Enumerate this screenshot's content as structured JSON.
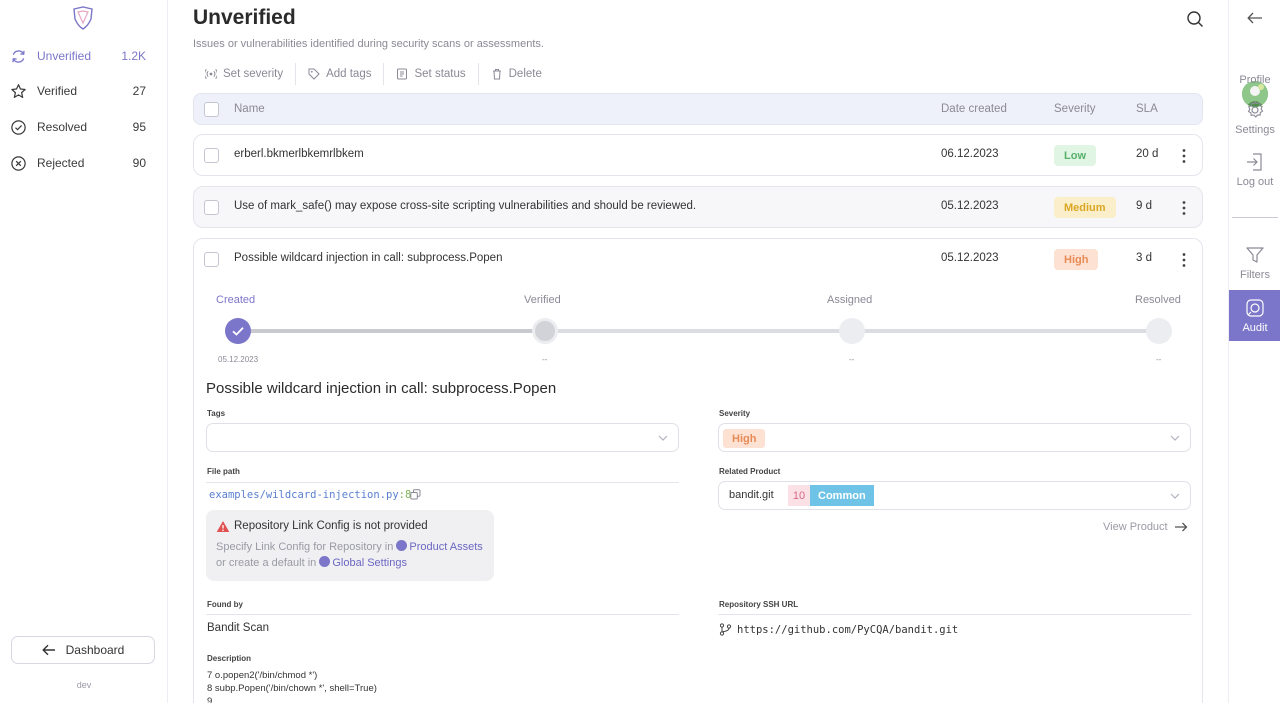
{
  "sidebar": {
    "items": [
      {
        "label": "Unverified",
        "count": "1.2K",
        "icon": "refresh-icon"
      },
      {
        "label": "Verified",
        "count": "27",
        "icon": "star-icon"
      },
      {
        "label": "Resolved",
        "count": "95",
        "icon": "check-circle-icon"
      },
      {
        "label": "Rejected",
        "count": "90",
        "icon": "x-circle-icon"
      }
    ],
    "dashboard_label": "Dashboard",
    "env": "dev"
  },
  "header": {
    "title": "Unverified",
    "subtitle": "Issues or vulnerabilities identified during security scans or assessments."
  },
  "toolbar": {
    "set_severity": "Set severity",
    "add_tags": "Add tags",
    "set_status": "Set status",
    "delete": "Delete"
  },
  "table": {
    "columns": {
      "name": "Name",
      "date": "Date created",
      "severity": "Severity",
      "sla": "SLA"
    },
    "rows": [
      {
        "name": "erberl.bkmerlbkemrlbkem",
        "date": "06.12.2023",
        "severity": "Low",
        "sla": "20 d"
      },
      {
        "name": "Use of mark_safe() may expose cross-site scripting vulnerabilities and should be reviewed.",
        "date": "05.12.2023",
        "severity": "Medium",
        "sla": "9 d"
      },
      {
        "name": "Possible wildcard injection in call: subprocess.Popen",
        "date": "05.12.2023",
        "severity": "High",
        "sla": "3 d"
      }
    ]
  },
  "details": {
    "steps": [
      {
        "label": "Created",
        "date": "05.12.2023"
      },
      {
        "label": "Verified",
        "date": "--"
      },
      {
        "label": "Assigned",
        "date": "--"
      },
      {
        "label": "Resolved",
        "date": "--"
      }
    ],
    "title": "Possible wildcard injection in call: subprocess.Popen",
    "tags_label": "Tags",
    "severity_label": "Severity",
    "severity_value": "High",
    "file_path_label": "File path",
    "file_path": "examples/wildcard-injection.py",
    "file_line": ":8",
    "related_product_label": "Related Product",
    "product_name": "bandit.git",
    "product_count": "10",
    "product_tag": "Common",
    "view_product": "View Product",
    "warning_title": "Repository Link Config is not provided",
    "warning_text_1": "Specify Link Config for Repository in",
    "warning_link_1": "Product Assets",
    "warning_text_2": "or create a default in",
    "warning_link_2": "Global Settings",
    "found_by_label": "Found by",
    "found_by": "Bandit Scan",
    "ssh_label": "Repository SSH URL",
    "ssh_url": "https://github.com/PyCQA/bandit.git",
    "description_label": "Description",
    "description": "7 o.popen2('/bin/chmod *')\n8 subp.Popen('/bin/chown *', shell=True)\n9"
  },
  "rail": {
    "profile": "Profile",
    "settings": "Settings",
    "logout": "Log out",
    "filters": "Filters",
    "audit": "Audit"
  },
  "colors": {
    "accent": "#7b76c9",
    "low": "#56b06a",
    "medium": "#d9a623",
    "high": "#e88a55"
  }
}
